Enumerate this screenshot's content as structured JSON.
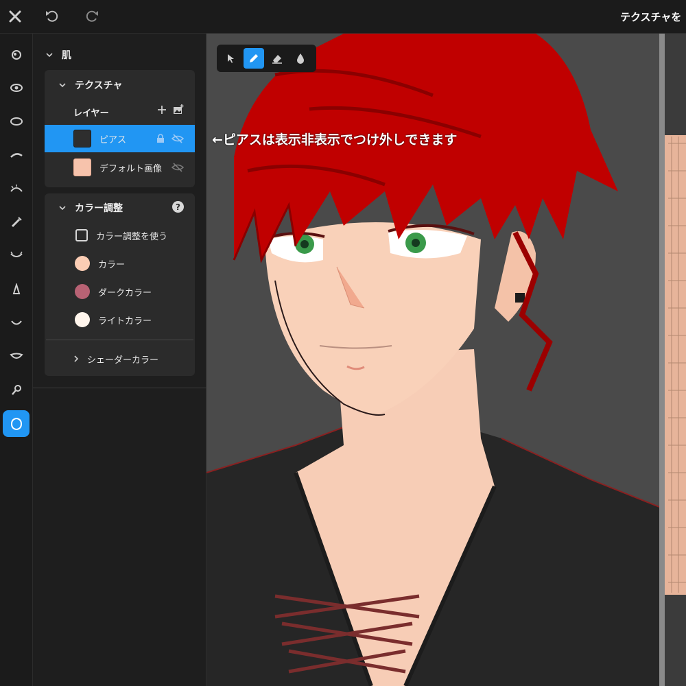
{
  "topbar": {
    "title": "テクスチャを"
  },
  "section": {
    "title": "肌"
  },
  "texture": {
    "title": "テクスチャ",
    "layers_label": "レイヤー",
    "layers": [
      {
        "name": "ピアス",
        "selected": true
      },
      {
        "name": "デフォルト画像",
        "selected": false
      }
    ]
  },
  "color_adjust": {
    "title": "カラー調整",
    "use_label": "カラー調整を使う",
    "colors": [
      {
        "label": "カラー",
        "swatch": "#fbcdb4"
      },
      {
        "label": "ダークカラー",
        "swatch": "#b86274"
      },
      {
        "label": "ライトカラー",
        "swatch": "#fff5ec"
      }
    ],
    "shader_label": "シェーダーカラー"
  },
  "annotation": "←ピアスは表示非表示でつけ外しできます",
  "colors": {
    "accent": "#2196f3",
    "panel": "#2b2b2b",
    "viewport": "#4a4a4a"
  },
  "icons": {
    "topbar": [
      "close-icon",
      "undo-icon",
      "redo-icon"
    ],
    "toolbar": [
      "select-arrow-icon",
      "pen-icon",
      "eraser-icon",
      "fill-drop-icon"
    ],
    "sidebar": [
      "face-icon",
      "eye-icon",
      "eye-white-icon",
      "eyebrow-icon",
      "eyelash-icon",
      "eyeliner-icon",
      "lower-lash-icon",
      "nose-icon",
      "mouth-icon",
      "teeth-icon",
      "ear-icon",
      "skin-icon"
    ]
  }
}
